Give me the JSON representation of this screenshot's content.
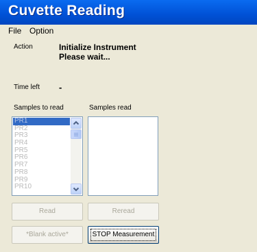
{
  "window": {
    "title": "Cuvette Reading"
  },
  "menu": {
    "items": [
      "File",
      "Option"
    ]
  },
  "action": {
    "label": "Action",
    "line1": "Initialize Instrument",
    "line2": "Please wait..."
  },
  "time": {
    "label": "Time left",
    "value": "-"
  },
  "samples_to_read": {
    "label": "Samples to read",
    "items": [
      "PR1",
      "PR2",
      "PR3",
      "PR4",
      "PR5",
      "PR6",
      "PR7",
      "PR8",
      "PR9",
      "PR10"
    ],
    "selected_index": 0
  },
  "samples_read": {
    "label": "Samples read",
    "items": []
  },
  "buttons": {
    "read": "Read",
    "reread": "Reread",
    "blank": "*Blank active*",
    "stop": "STOP Measurement"
  },
  "icons": {
    "scroll_up": "chevron-up-icon",
    "scroll_down": "chevron-down-icon"
  }
}
